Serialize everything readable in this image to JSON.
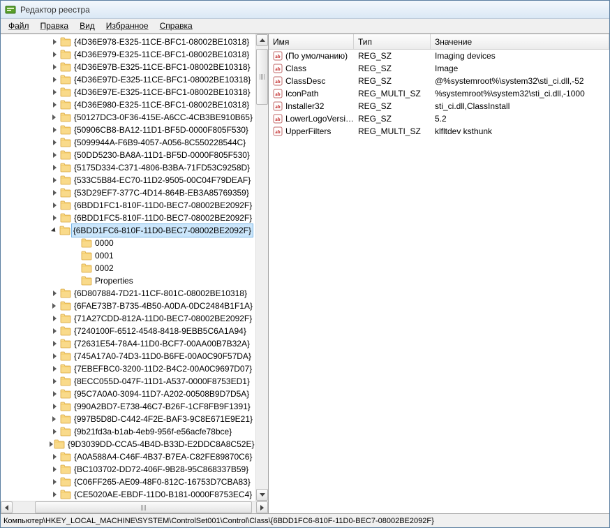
{
  "window": {
    "title": "Редактор реестра"
  },
  "menu": {
    "file": "Файл",
    "edit": "Правка",
    "view": "Вид",
    "favorites": "Избранное",
    "help": "Справка"
  },
  "tree": {
    "items": [
      {
        "label": "{4D36E978-E325-11CE-BFC1-08002BE10318}",
        "open": false
      },
      {
        "label": "{4D36E979-E325-11CE-BFC1-08002BE10318}",
        "open": false
      },
      {
        "label": "{4D36E97B-E325-11CE-BFC1-08002BE10318}",
        "open": false
      },
      {
        "label": "{4D36E97D-E325-11CE-BFC1-08002BE10318}",
        "open": false
      },
      {
        "label": "{4D36E97E-E325-11CE-BFC1-08002BE10318}",
        "open": false
      },
      {
        "label": "{4D36E980-E325-11CE-BFC1-08002BE10318}",
        "open": false
      },
      {
        "label": "{50127DC3-0F36-415E-A6CC-4CB3BE910B65}",
        "open": false
      },
      {
        "label": "{50906CB8-BA12-11D1-BF5D-0000F805F530}",
        "open": false
      },
      {
        "label": "{5099944A-F6B9-4057-A056-8C550228544C}",
        "open": false
      },
      {
        "label": "{50DD5230-BA8A-11D1-BF5D-0000F805F530}",
        "open": false
      },
      {
        "label": "{5175D334-C371-4806-B3BA-71FD53C9258D}",
        "open": false
      },
      {
        "label": "{533C5B84-EC70-11D2-9505-00C04F79DEAF}",
        "open": false
      },
      {
        "label": "{53D29EF7-377C-4D14-864B-EB3A85769359}",
        "open": false
      },
      {
        "label": "{6BDD1FC1-810F-11D0-BEC7-08002BE2092F}",
        "open": false
      },
      {
        "label": "{6BDD1FC5-810F-11D0-BEC7-08002BE2092F}",
        "open": false
      },
      {
        "label": "{6BDD1FC6-810F-11D0-BEC7-08002BE2092F}",
        "open": true,
        "selected": true
      },
      {
        "label": "0000",
        "child": true
      },
      {
        "label": "0001",
        "child": true
      },
      {
        "label": "0002",
        "child": true
      },
      {
        "label": "Properties",
        "child": true
      },
      {
        "label": "{6D807884-7D21-11CF-801C-08002BE10318}",
        "open": false
      },
      {
        "label": "{6FAE73B7-B735-4B50-A0DA-0DC2484B1F1A}",
        "open": false
      },
      {
        "label": "{71A27CDD-812A-11D0-BEC7-08002BE2092F}",
        "open": false
      },
      {
        "label": "{7240100F-6512-4548-8418-9EBB5C6A1A94}",
        "open": false
      },
      {
        "label": "{72631E54-78A4-11D0-BCF7-00AA00B7B32A}",
        "open": false
      },
      {
        "label": "{745A17A0-74D3-11D0-B6FE-00A0C90F57DA}",
        "open": false
      },
      {
        "label": "{7EBEFBC0-3200-11D2-B4C2-00A0C9697D07}",
        "open": false
      },
      {
        "label": "{8ECC055D-047F-11D1-A537-0000F8753ED1}",
        "open": false
      },
      {
        "label": "{95C7A0A0-3094-11D7-A202-00508B9D7D5A}",
        "open": false
      },
      {
        "label": "{990A2BD7-E738-46C7-B26F-1CF8FB9F1391}",
        "open": false
      },
      {
        "label": "{997B5D8D-C442-4F2E-BAF3-9C8E671E9E21}",
        "open": false
      },
      {
        "label": "{9b21fd3a-b1ab-4eb9-956f-e56acfe78bce}",
        "open": false
      },
      {
        "label": "{9D3039DD-CCA5-4B4D-B33D-E2DDC8A8C52E}",
        "open": false
      },
      {
        "label": "{A0A588A4-C46F-4B37-B7EA-C82FE89870C6}",
        "open": false
      },
      {
        "label": "{BC103702-DD72-406F-9B28-95C868337B59}",
        "open": false
      },
      {
        "label": "{C06FF265-AE09-48F0-812C-16753D7CBA83}",
        "open": false
      },
      {
        "label": "{CE5020AE-EBDF-11D0-B181-0000F8753EC4}",
        "open": false
      }
    ]
  },
  "list": {
    "headers": {
      "name": "Имя",
      "type": "Тип",
      "value": "Значение"
    },
    "rows": [
      {
        "name": "(По умолчанию)",
        "type": "REG_SZ",
        "value": "Imaging devices"
      },
      {
        "name": "Class",
        "type": "REG_SZ",
        "value": "Image"
      },
      {
        "name": "ClassDesc",
        "type": "REG_SZ",
        "value": "@%systemroot%\\system32\\sti_ci.dll,-52"
      },
      {
        "name": "IconPath",
        "type": "REG_MULTI_SZ",
        "value": "%systemroot%\\system32\\sti_ci.dll,-1000"
      },
      {
        "name": "Installer32",
        "type": "REG_SZ",
        "value": "sti_ci.dll,ClassInstall"
      },
      {
        "name": "LowerLogoVersi…",
        "type": "REG_SZ",
        "value": "5.2"
      },
      {
        "name": "UpperFilters",
        "type": "REG_MULTI_SZ",
        "value": "klfltdev ksthunk"
      }
    ]
  },
  "status": {
    "path": "Компьютер\\HKEY_LOCAL_MACHINE\\SYSTEM\\ControlSet001\\Control\\Class\\{6BDD1FC6-810F-11D0-BEC7-08002BE2092F}"
  }
}
